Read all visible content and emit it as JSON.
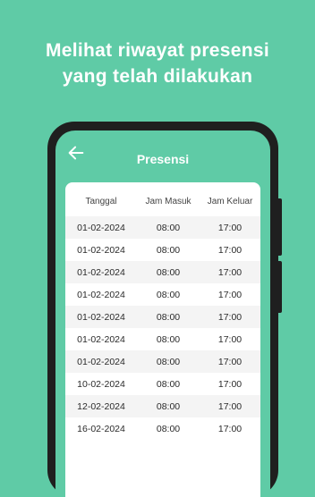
{
  "headline": {
    "line1": "Melihat riwayat presensi",
    "line2": "yang telah dilakukan"
  },
  "colors": {
    "background": "#5fcba6",
    "phone_frame": "#1f1f1f",
    "card": "#ffffff"
  },
  "appbar": {
    "back_icon": "arrow-left-icon",
    "title": "Presensi"
  },
  "table": {
    "headers": [
      "Tanggal",
      "Jam Masuk",
      "Jam Keluar"
    ],
    "rows": [
      [
        "01-02-2024",
        "08:00",
        "17:00"
      ],
      [
        "01-02-2024",
        "08:00",
        "17:00"
      ],
      [
        "01-02-2024",
        "08:00",
        "17:00"
      ],
      [
        "01-02-2024",
        "08:00",
        "17:00"
      ],
      [
        "01-02-2024",
        "08:00",
        "17:00"
      ],
      [
        "01-02-2024",
        "08:00",
        "17:00"
      ],
      [
        "01-02-2024",
        "08:00",
        "17:00"
      ],
      [
        "10-02-2024",
        "08:00",
        "17:00"
      ],
      [
        "12-02-2024",
        "08:00",
        "17:00"
      ],
      [
        "16-02-2024",
        "08:00",
        "17:00"
      ]
    ]
  }
}
